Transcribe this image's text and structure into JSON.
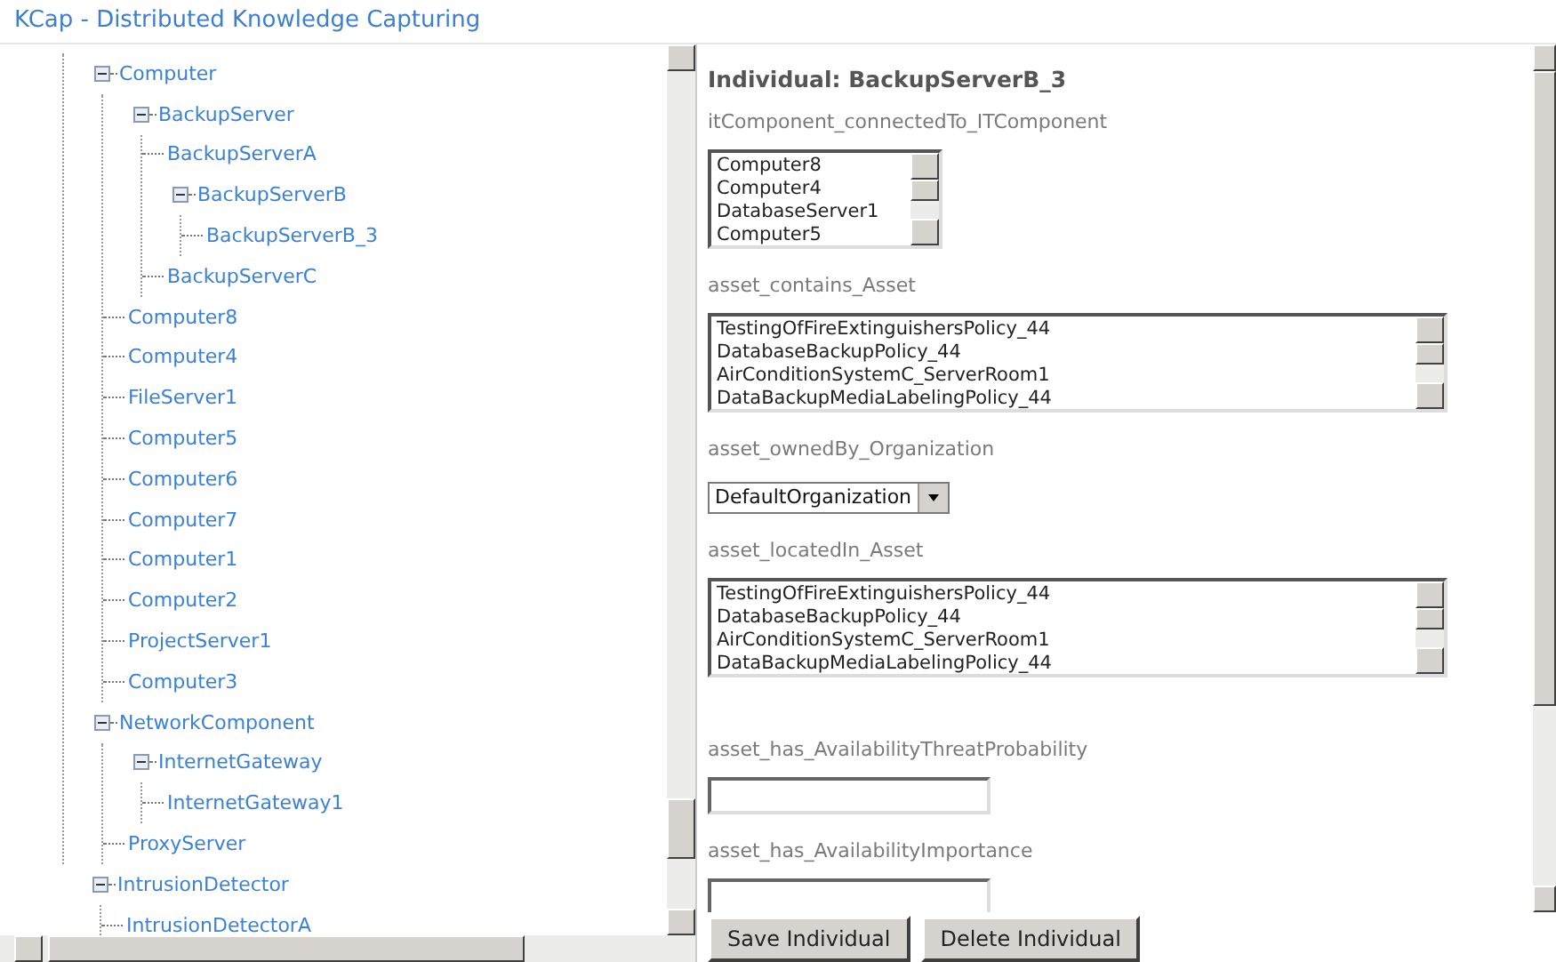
{
  "window": {
    "title": "KCap - Distributed Knowledge Capturing"
  },
  "tree": {
    "children": [
      {
        "children": [
          {
            "label": "Computer",
            "expanded": true,
            "children": [
              {
                "label": "BackupServer",
                "expanded": true,
                "children": [
                  {
                    "label": "BackupServerA"
                  },
                  {
                    "label": "BackupServerB",
                    "expanded": true,
                    "children": [
                      {
                        "label": "BackupServerB_3"
                      }
                    ]
                  },
                  {
                    "label": "BackupServerC"
                  }
                ]
              },
              {
                "label": "Computer8"
              },
              {
                "label": "Computer4"
              },
              {
                "label": "FileServer1"
              },
              {
                "label": "Computer5"
              },
              {
                "label": "Computer6"
              },
              {
                "label": "Computer7"
              },
              {
                "label": "Computer1"
              },
              {
                "label": "Computer2"
              },
              {
                "label": "ProjectServer1"
              },
              {
                "label": "Computer3"
              }
            ]
          },
          {
            "label": "NetworkComponent",
            "expanded": true,
            "children": [
              {
                "label": "InternetGateway",
                "expanded": true,
                "children": [
                  {
                    "label": "InternetGateway1"
                  }
                ]
              },
              {
                "label": "ProxyServer"
              }
            ]
          }
        ]
      },
      {
        "label": "IntrusionDetector",
        "expanded": true,
        "children": [
          {
            "label": "IntrusionDetectorA"
          }
        ]
      }
    ]
  },
  "detail": {
    "heading": "Individual: BackupServerB_3",
    "fields": [
      {
        "kind": "listbox",
        "label": "itComponent_connectedTo_ITComponent",
        "options": [
          "Computer8",
          "Computer4",
          "DatabaseServer1",
          "Computer5"
        ]
      },
      {
        "kind": "wide-listbox",
        "label": "asset_contains_Asset",
        "options": [
          "TestingOfFireExtinguishersPolicy_44",
          "DatabaseBackupPolicy_44",
          "AirConditionSystemC_ServerRoom1",
          "DataBackupMediaLabelingPolicy_44"
        ]
      },
      {
        "kind": "select",
        "label": "asset_ownedBy_Organization",
        "value": "DefaultOrganization"
      },
      {
        "kind": "wide-listbox",
        "label": "asset_locatedIn_Asset",
        "options": [
          "TestingOfFireExtinguishersPolicy_44",
          "DatabaseBackupPolicy_44",
          "AirConditionSystemC_ServerRoom1",
          "DataBackupMediaLabelingPolicy_44"
        ]
      },
      {
        "kind": "text",
        "label": "asset_has_AvailabilityThreatProbability"
      },
      {
        "kind": "text",
        "label": "asset_has_AvailabilityImportance"
      }
    ]
  },
  "buttons": [
    "Save Individual",
    "Delete Individual"
  ]
}
